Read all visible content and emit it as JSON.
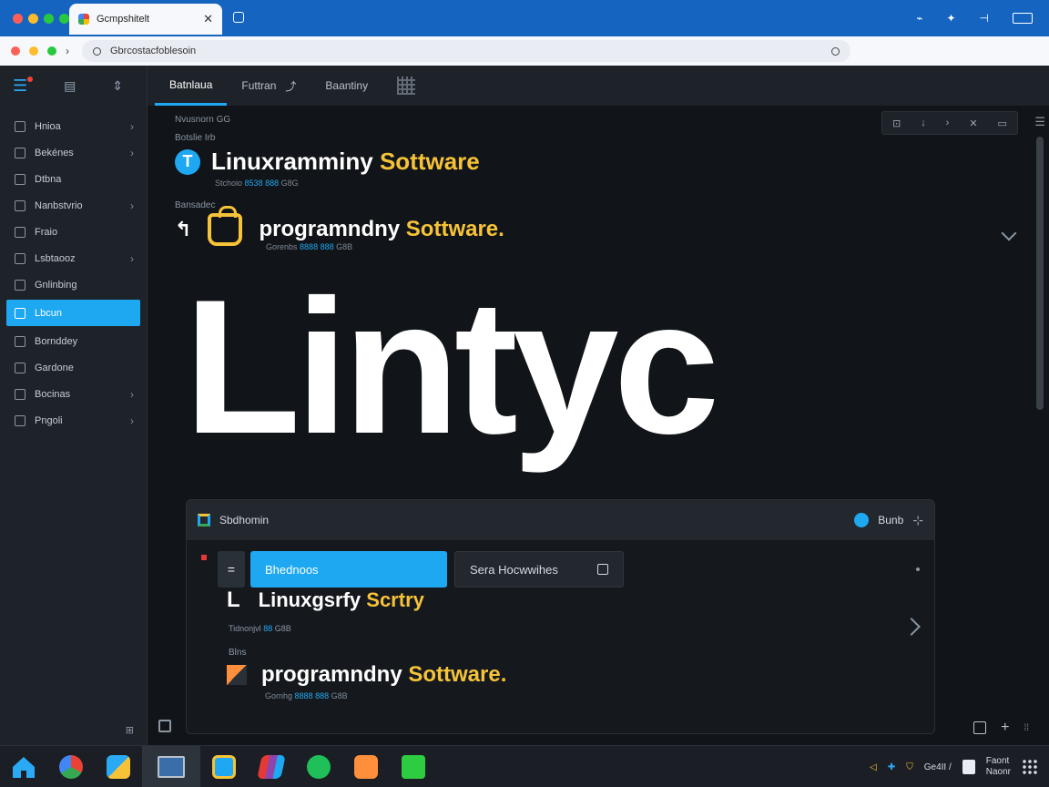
{
  "browser": {
    "tab_title": "Gcmpshitelt",
    "tab_close": "✕",
    "url": "Gbrcostacfoblesoin",
    "title_actions": [
      "⌁",
      "✦",
      "⊣"
    ],
    "address_actions": [
      "◐",
      "✂",
      "⧉",
      "⁙"
    ]
  },
  "sidebar": {
    "items": [
      {
        "label": "Hnioa",
        "chevron": "›"
      },
      {
        "label": "Bekénes",
        "chevron": "›"
      },
      {
        "label": "Dtbna",
        "chevron": ""
      },
      {
        "label": "Nanbstvrio",
        "chevron": "›"
      },
      {
        "label": "Fraio",
        "chevron": ""
      },
      {
        "label": "Lsbtaooz",
        "chevron": "›"
      },
      {
        "label": "Gnlinbing",
        "chevron": ""
      },
      {
        "label": "Lbcun",
        "chevron": "",
        "active": true
      },
      {
        "label": "Bornddey",
        "chevron": ""
      },
      {
        "label": "Gardone",
        "chevron": ""
      },
      {
        "label": "Bocinas",
        "chevron": "›"
      },
      {
        "label": "Pngoli",
        "chevron": "›"
      }
    ],
    "bottom_icon": "⊞"
  },
  "tabs": [
    {
      "label": "Batnlaua",
      "active": true
    },
    {
      "label": "Futtran",
      "active": false
    },
    {
      "label": "Baantiny",
      "active": false
    }
  ],
  "content": {
    "breadcrumb": "Nvusnorn GG",
    "section_small": "Botslie Irb",
    "row1": {
      "heading_white": "Linuxramminy",
      "heading_yellow": "Sottware",
      "meta_gray": "Stchoio",
      "meta_blue": "8538 888",
      "meta_tail": "G8G"
    },
    "section_label": "Bansadec",
    "row2": {
      "heading_white": "programndny",
      "heading_yellow": "Sottware.",
      "meta_gray": "Gorenbs",
      "meta_blue": "8888 888",
      "meta_tail": "G8B"
    },
    "hero": "Lintyc",
    "toolbar_icons": [
      "⊡",
      "↓",
      "›",
      "✕",
      "▭"
    ]
  },
  "panel": {
    "title": "Sbdhomin",
    "user_label": "Bunb",
    "pin": "⊹",
    "primary_button": "Bhednoos",
    "secondary_button": "Sera Hocwwihes",
    "menu_icon": "=",
    "row1": {
      "heading_white": "Linuxgsrfy",
      "heading_yellow": "Scrtry",
      "meta_gray": "Tidnonjvl",
      "meta_blue": "88",
      "meta_tail": "G8B"
    },
    "label": "Blns",
    "row2": {
      "heading_white": "programndny",
      "heading_yellow": "Sottware.",
      "meta_gray": "Gornhg",
      "meta_blue": "8888 888",
      "meta_tail": "G8B"
    }
  },
  "bottom_controls": {
    "plus": "+",
    "side_glyph": "⁞⁞"
  },
  "taskbar": {
    "apps": [
      "home",
      "browser",
      "files",
      "window",
      "store",
      "cards",
      "music",
      "gift",
      "terminal"
    ],
    "tray_text": "Ge4II /",
    "clock_top": "Faont",
    "clock_bottom": "Naonr"
  },
  "colors": {
    "accent": "#1fa8f2",
    "yellow": "#f6c338",
    "titlebar": "#1565c0",
    "traffic": [
      "#ff5f57",
      "#febc2e",
      "#28c840",
      "#28c840"
    ]
  }
}
